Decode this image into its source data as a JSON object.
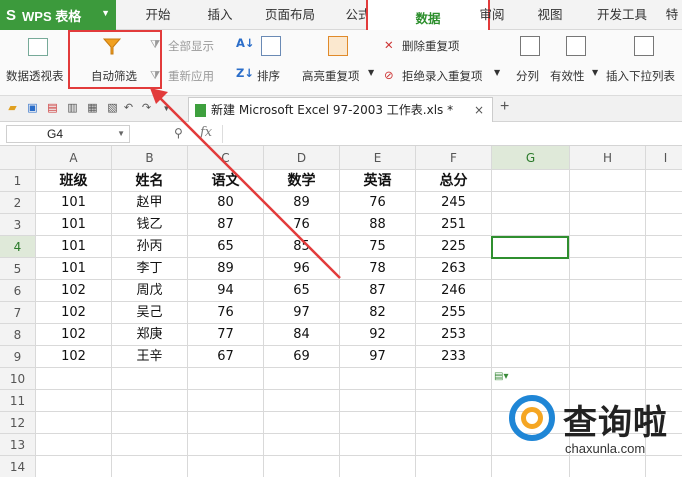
{
  "app": {
    "title": "WPS 表格"
  },
  "menu": {
    "tabs": [
      {
        "label": "开始"
      },
      {
        "label": "插入"
      },
      {
        "label": "页面布局"
      },
      {
        "label": "公式"
      },
      {
        "label": "数据"
      },
      {
        "label": "审阅"
      },
      {
        "label": "视图"
      },
      {
        "label": "开发工具"
      },
      {
        "label": "特"
      }
    ],
    "active": "数据"
  },
  "ribbon": {
    "pivot": "数据透视表",
    "autofilter": "自动筛选",
    "show_all": "全部显示",
    "reapply": "重新应用",
    "sort": "排序",
    "highlight_dup": "高亮重复项",
    "remove_dup": "删除重复项",
    "reject_dup": "拒绝录入重复项",
    "split": "分列",
    "validity": "有效性",
    "dropdown": "插入下拉列表"
  },
  "document": {
    "tab_title": "新建 Microsoft Excel 97-2003 工作表.xls *",
    "close": "×",
    "new_tab": "+"
  },
  "formula_bar": {
    "cell_ref": "G4",
    "fx": "fx"
  },
  "sheet": {
    "columns": [
      "A",
      "B",
      "C",
      "D",
      "E",
      "F",
      "G",
      "H",
      "I"
    ],
    "rows": [
      "1",
      "2",
      "3",
      "4",
      "5",
      "6",
      "7",
      "8",
      "9",
      "10",
      "11",
      "12",
      "13",
      "14"
    ],
    "header": [
      "班级",
      "姓名",
      "语文",
      "数学",
      "英语",
      "总分"
    ],
    "data": [
      [
        "101",
        "赵甲",
        "80",
        "89",
        "76",
        "245"
      ],
      [
        "101",
        "钱乙",
        "87",
        "76",
        "88",
        "251"
      ],
      [
        "101",
        "孙丙",
        "65",
        "85",
        "75",
        "225"
      ],
      [
        "101",
        "李丁",
        "89",
        "96",
        "78",
        "263"
      ],
      [
        "102",
        "周戊",
        "94",
        "65",
        "87",
        "246"
      ],
      [
        "102",
        "吴己",
        "76",
        "97",
        "82",
        "255"
      ],
      [
        "102",
        "郑庚",
        "77",
        "84",
        "92",
        "253"
      ],
      [
        "102",
        "王辛",
        "67",
        "69",
        "97",
        "233"
      ]
    ],
    "active_cell": "G4"
  },
  "watermark": {
    "text": "查询啦",
    "url": "chaxunla.com"
  },
  "colors": {
    "accent": "#3c9a3c",
    "highlight": "#e23b3b",
    "watermark_blue": "#1f86d6",
    "watermark_orange": "#f5a623"
  }
}
